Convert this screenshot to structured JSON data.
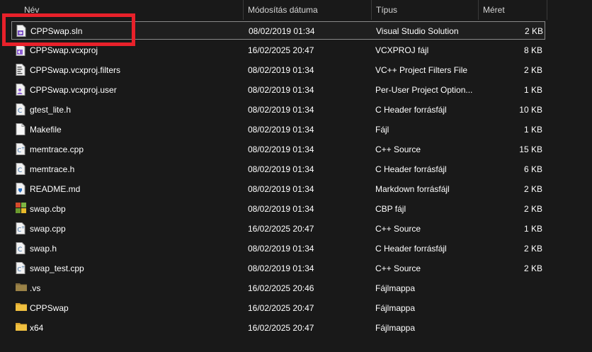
{
  "header": {
    "name": "Név",
    "date": "Módosítás dátuma",
    "type": "Típus",
    "size": "Méret"
  },
  "files": [
    {
      "name": "CPPSwap.sln",
      "date": "08/02/2019 01:34",
      "type": "Visual Studio Solution",
      "size": "2 KB",
      "icon": "solution-icon",
      "selected": true
    },
    {
      "name": "CPPSwap.vcxproj",
      "date": "16/02/2025 20:47",
      "type": "VCXPROJ fájl",
      "size": "8 KB",
      "icon": "vcxproj-icon"
    },
    {
      "name": "CPPSwap.vcxproj.filters",
      "date": "08/02/2019 01:34",
      "type": "VC++ Project Filters File",
      "size": "2 KB",
      "icon": "filters-icon"
    },
    {
      "name": "CPPSwap.vcxproj.user",
      "date": "08/02/2019 01:34",
      "type": "Per-User Project Option...",
      "size": "1 KB",
      "icon": "user-project-icon"
    },
    {
      "name": "gtest_lite.h",
      "date": "08/02/2019 01:34",
      "type": "C Header forrásfájl",
      "size": "10 KB",
      "icon": "c-header-icon"
    },
    {
      "name": "Makefile",
      "date": "08/02/2019 01:34",
      "type": "Fájl",
      "size": "1 KB",
      "icon": "blank-file-icon"
    },
    {
      "name": "memtrace.cpp",
      "date": "08/02/2019 01:34",
      "type": "C++ Source",
      "size": "15 KB",
      "icon": "cpp-source-icon"
    },
    {
      "name": "memtrace.h",
      "date": "08/02/2019 01:34",
      "type": "C Header forrásfájl",
      "size": "6 KB",
      "icon": "c-header-icon"
    },
    {
      "name": "README.md",
      "date": "08/02/2019 01:34",
      "type": "Markdown forrásfájl",
      "size": "2 KB",
      "icon": "markdown-icon"
    },
    {
      "name": "swap.cbp",
      "date": "08/02/2019 01:34",
      "type": "CBP fájl",
      "size": "2 KB",
      "icon": "codeblocks-icon"
    },
    {
      "name": "swap.cpp",
      "date": "16/02/2025 20:47",
      "type": "C++ Source",
      "size": "1 KB",
      "icon": "cpp-source-icon"
    },
    {
      "name": "swap.h",
      "date": "08/02/2019 01:34",
      "type": "C Header forrásfájl",
      "size": "2 KB",
      "icon": "c-header-icon"
    },
    {
      "name": "swap_test.cpp",
      "date": "08/02/2019 01:34",
      "type": "C++ Source",
      "size": "2 KB",
      "icon": "cpp-source-icon"
    },
    {
      "name": ".vs",
      "date": "16/02/2025 20:46",
      "type": "Fájlmappa",
      "size": "",
      "icon": "hidden-folder-icon"
    },
    {
      "name": "CPPSwap",
      "date": "16/02/2025 20:47",
      "type": "Fájlmappa",
      "size": "",
      "icon": "folder-icon"
    },
    {
      "name": "x64",
      "date": "16/02/2025 20:47",
      "type": "Fájlmappa",
      "size": "",
      "icon": "folder-icon"
    }
  ],
  "colors": {
    "background": "#191919",
    "highlight": "#e8212a",
    "folder": "#e8b43a"
  }
}
